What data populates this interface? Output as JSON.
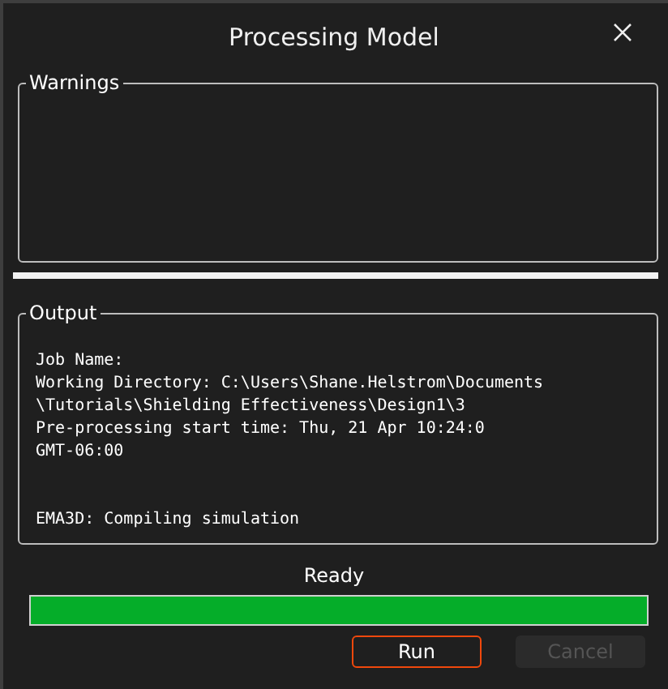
{
  "window": {
    "title": "Processing Model"
  },
  "warnings": {
    "label": "Warnings"
  },
  "output": {
    "label": "Output",
    "blocks": [
      [
        "Job Name:",
        "Working Directory: C:\\Users\\Shane.Helstrom\\Documents",
        "\\Tutorials\\Shielding Effectiveness\\Design1\\3",
        "Pre-processing start time: Thu, 21 Apr 10:24:0",
        "GMT-06:00"
      ],
      [
        "EMA3D: Compiling simulation"
      ]
    ]
  },
  "status": {
    "text": "Ready",
    "level": 1
  },
  "buttons": [
    {
      "label": "Run",
      "disabled": false,
      "focused": true
    },
    {
      "label": "Cancel",
      "disabled": true,
      "focused": false
    }
  ]
}
